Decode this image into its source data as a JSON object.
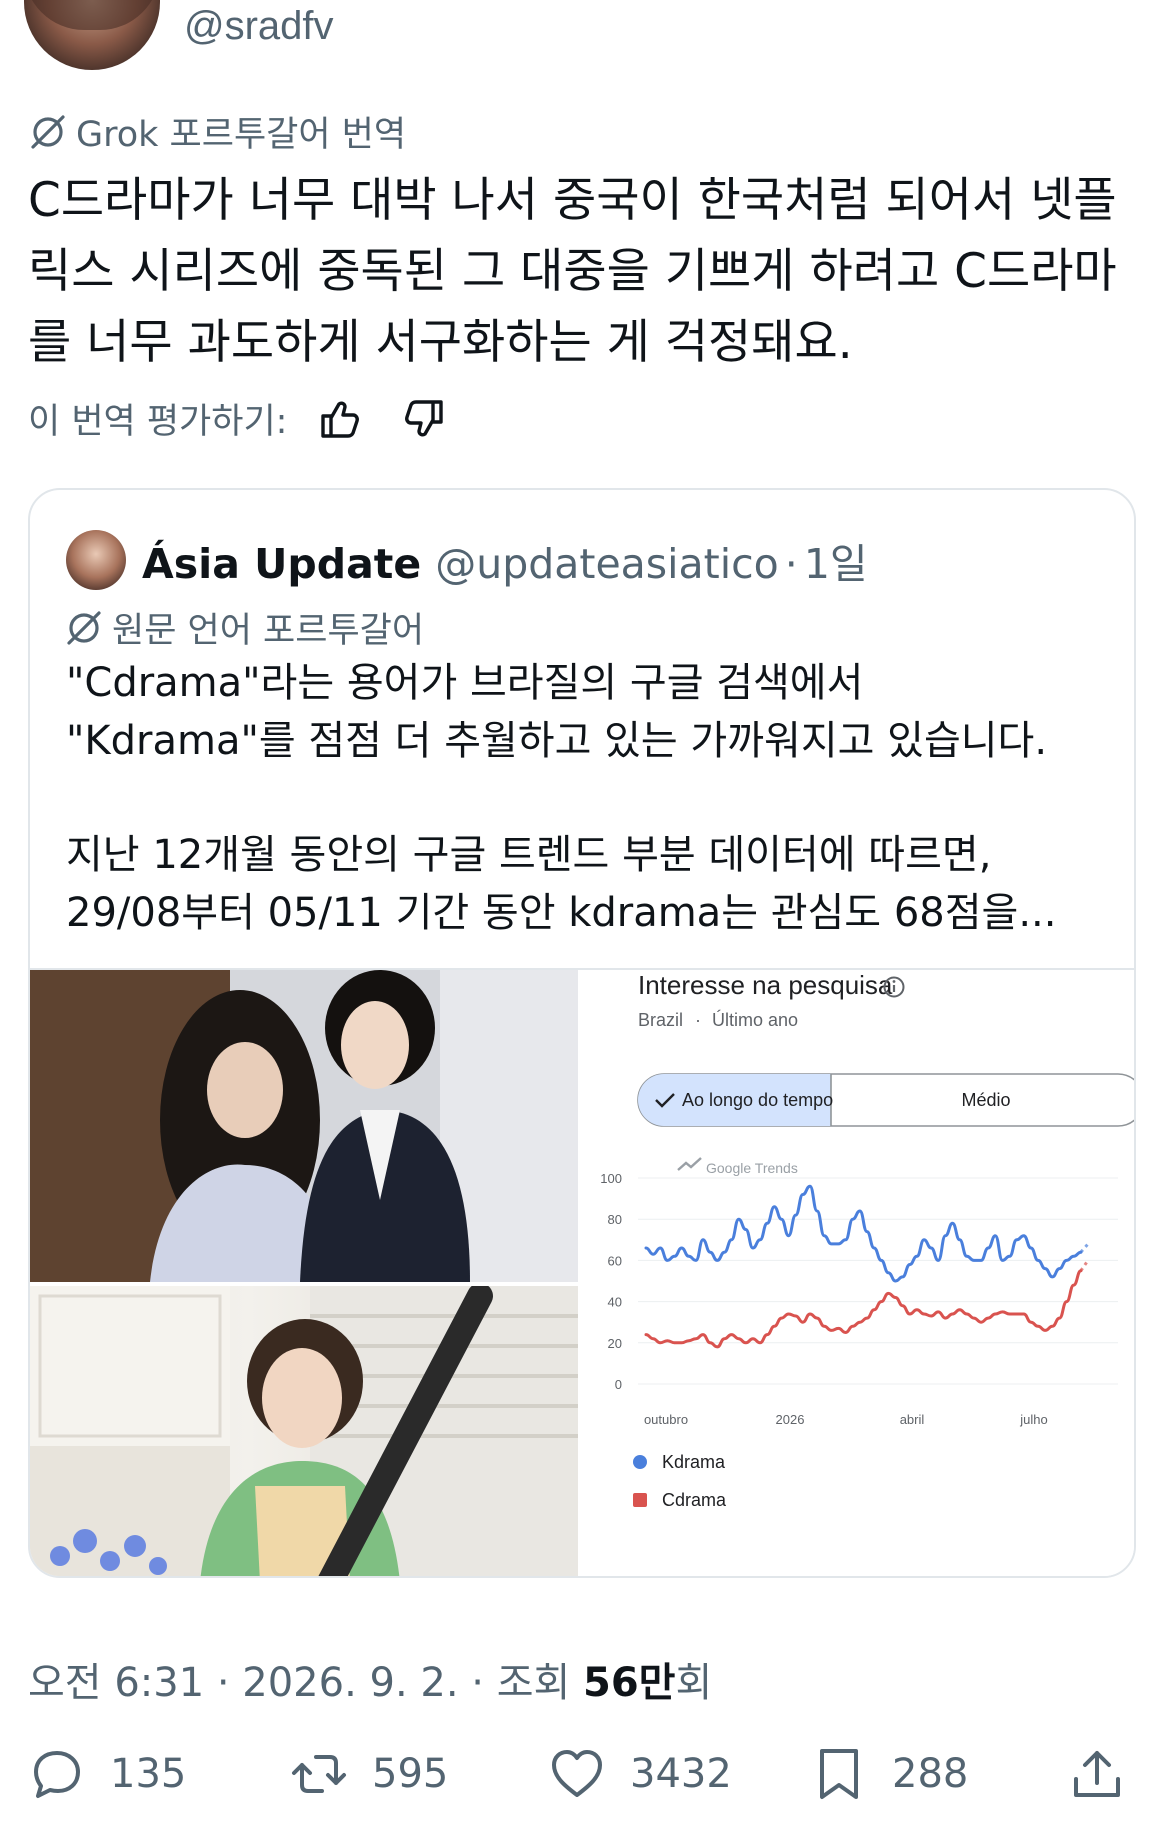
{
  "author": {
    "handle": "@sradfv"
  },
  "translation": {
    "label": "Grok 포르투갈어 번역"
  },
  "tweet": {
    "lines": [
      "C드라마가 너무 대박 나서 중국이 한국처럼 되어서 넷플",
      "릭스 시리즈에 중독된 그 대중을 기쁘게 하려고 C드라마",
      "를 너무 과도하게 서구화하는 게 걱정돼요."
    ]
  },
  "rating": {
    "label": "이 번역 평가하기:",
    "up_icon": "thumbs-up-icon",
    "down_icon": "thumbs-down-icon"
  },
  "quote": {
    "name": "Ásia Update",
    "handle": "@updateasiatico",
    "dot": "·",
    "time": "1일",
    "lang_label": "원문 언어 포르투갈어",
    "paragraphs": [
      [
        "\"Cdrama\"라는 용어가 브라질의 구글 검색에서",
        "\"Kdrama\"를 점점 더 추월하고 있는 가까워지고 있습니다."
      ],
      [
        "지난 12개월 동안의 구글 트렌드 부분 데이터에 따르면,",
        "29/08부터 05/11 기간 동안 kdrama는 관심도 68점을..."
      ]
    ]
  },
  "trends": {
    "title": "Interesse na pesquisa",
    "subtitle_region": "Brazil",
    "subtitle_sep": "·",
    "subtitle_period": "Último ano",
    "toggle_left": "Ao longo do tempo",
    "toggle_right": "Médio",
    "watermark": "Google Trends"
  },
  "chart_data": {
    "type": "line",
    "title": "Interesse na pesquisa",
    "ylim": [
      0,
      100
    ],
    "yticks": [
      0,
      20,
      40,
      60,
      80,
      100
    ],
    "xticks": [
      "outubro",
      "2026",
      "abril",
      "julho"
    ],
    "grid": true,
    "legend": "bottom",
    "series": [
      {
        "name": "Kdrama",
        "color": "#4a7fdc",
        "values": [
          66,
          63,
          66,
          60,
          62,
          66,
          62,
          60,
          70,
          64,
          60,
          64,
          70,
          80,
          75,
          66,
          70,
          78,
          86,
          80,
          72,
          82,
          92,
          96,
          84,
          72,
          68,
          68,
          70,
          80,
          84,
          74,
          66,
          60,
          54,
          50,
          52,
          58,
          62,
          70,
          66,
          60,
          72,
          78,
          70,
          62,
          60,
          60,
          66,
          72,
          60,
          62,
          70,
          72,
          66,
          60,
          56,
          52,
          56,
          60,
          62,
          64,
          68
        ]
      },
      {
        "name": "Cdrama",
        "color": "#d9534f",
        "values": [
          24,
          22,
          20,
          21,
          20,
          20,
          21,
          22,
          24,
          20,
          18,
          22,
          24,
          22,
          20,
          22,
          20,
          24,
          28,
          32,
          34,
          33,
          30,
          34,
          32,
          28,
          26,
          27,
          25,
          28,
          30,
          32,
          36,
          40,
          44,
          42,
          38,
          34,
          36,
          34,
          33,
          35,
          32,
          34,
          36,
          34,
          32,
          30,
          32,
          34,
          35,
          34,
          34,
          34,
          30,
          28,
          26,
          28,
          32,
          40,
          48,
          55,
          60
        ]
      }
    ]
  },
  "footer": {
    "prefix": "오전 6:31 · 2026. 9. 2. · 조회 ",
    "views": "56만",
    "suffix": "회"
  },
  "actions": {
    "replies": "135",
    "retweets": "595",
    "likes": "3432",
    "bookmarks": "288"
  }
}
